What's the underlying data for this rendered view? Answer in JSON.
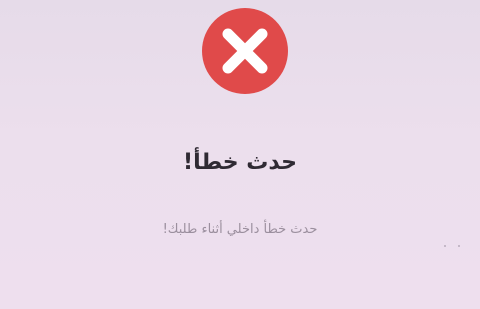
{
  "error_dialog": {
    "icon": "error-x-icon",
    "title": "حدث خطأ!",
    "message": "حدث خطأ داخلي أثناء طلبك!"
  },
  "colors": {
    "background": "#ecdfed",
    "error_red": "#e04a4a",
    "title_text": "#2f2a33",
    "message_text": "#9b8f9e"
  }
}
